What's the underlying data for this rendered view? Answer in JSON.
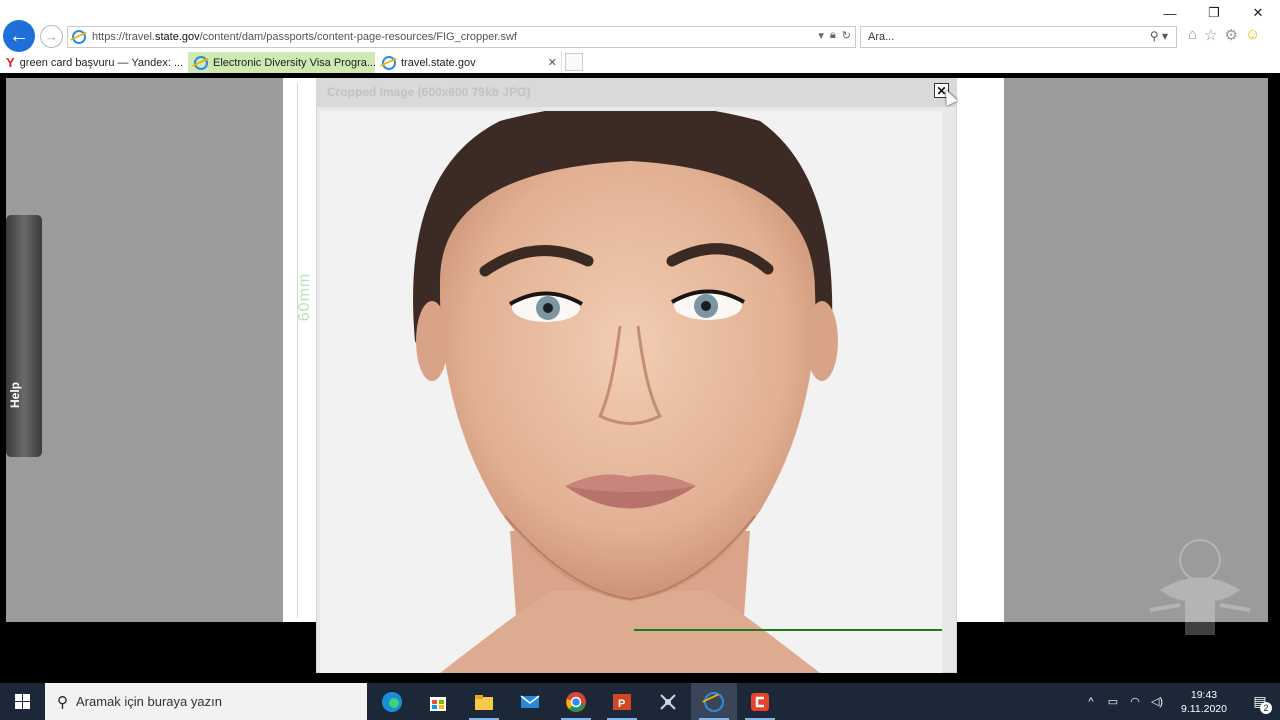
{
  "browser": {
    "url_prefix": "https://travel.",
    "url_domain": "state.gov",
    "url_path": "/content/dam/passports/content-page-resources/FIG_cropper.swf",
    "search_placeholder": "Ara...",
    "tabs": [
      {
        "label": "green card başvuru — Yandex: ...",
        "icon": "yandex-icon"
      },
      {
        "label": "Electronic Diversity Visa Progra...",
        "icon": "ie-icon"
      },
      {
        "label": "travel.state.gov",
        "icon": "ie-icon"
      }
    ],
    "toolbar_icons": [
      "home-icon",
      "favorites-star-icon",
      "settings-gear-icon",
      "feedback-smiley-icon"
    ]
  },
  "page": {
    "ruler_label": "60mm",
    "help_label": "Help",
    "dialog": {
      "title": "Cropped Image (600x600 79kb JPG)",
      "close_label": "✕"
    }
  },
  "taskbar": {
    "search_placeholder": "Aramak için buraya yazın",
    "apps": [
      "edge-icon",
      "store-icon",
      "file-explorer-icon",
      "mail-icon",
      "chrome-icon",
      "powerpoint-icon",
      "snipping-tool-icon",
      "internet-explorer-icon",
      "camtasia-icon"
    ],
    "time": "19:43",
    "date": "9.11.2020",
    "notifications": "2"
  }
}
